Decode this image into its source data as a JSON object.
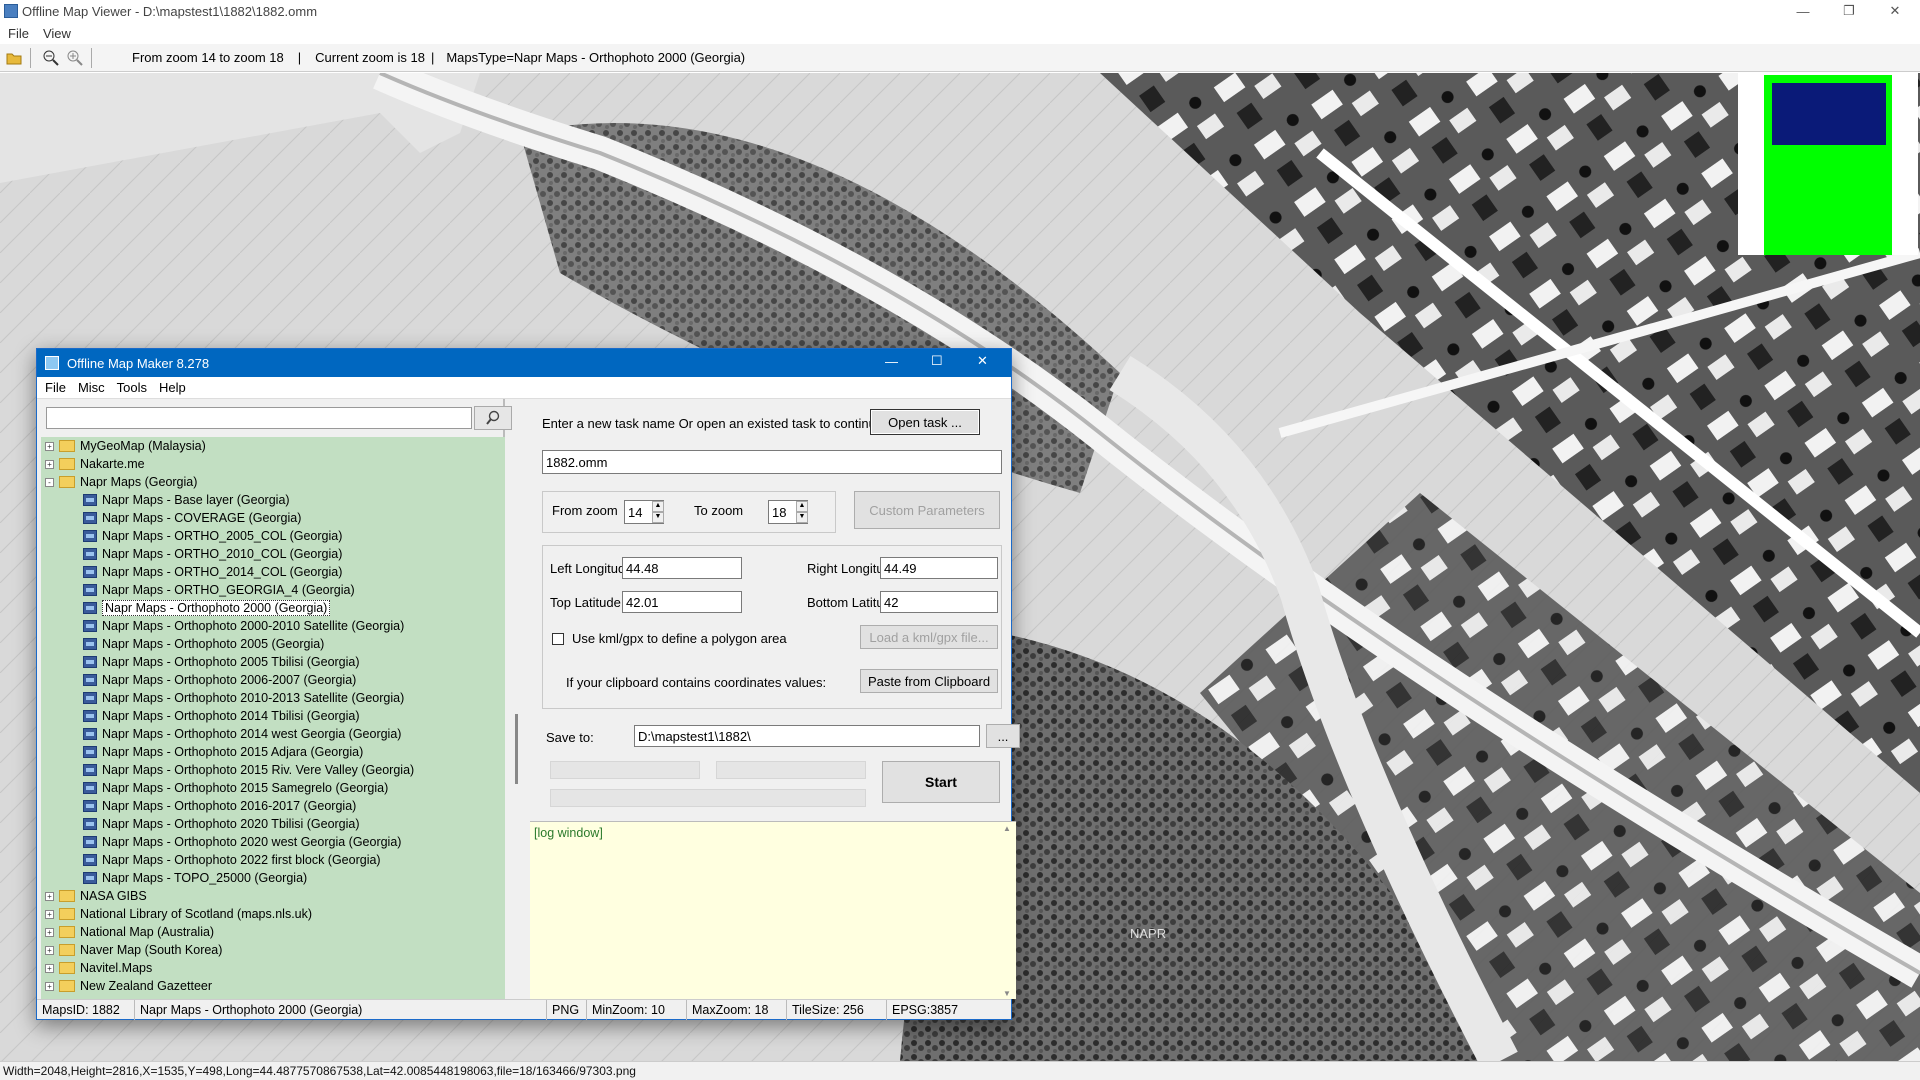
{
  "outer": {
    "title": "Offline Map Viewer - D:\\mapstest1\\1882\\1882.omm",
    "menu": [
      "File",
      "View"
    ],
    "toolbar_info": {
      "zoom_range": "From zoom 14 to zoom 18",
      "current_zoom": "Current zoom is 18",
      "maps_type": "MapsType=Napr Maps - Orthophoto 2000 (Georgia)"
    },
    "map_watermark": "NAPR",
    "status": "Width=2048,Height=2816,X=1535,Y=498,Long=44.4877570867538,Lat=42.0085448198063,file=18/163466/97303.png"
  },
  "colors": {
    "titlebar_blue": "#0067c0",
    "tree_bg": "#c2dfc2",
    "log_bg": "#ffffe0",
    "overview_green": "#00ff00",
    "overview_navy": "#0a1a78"
  },
  "inner": {
    "title": "Offline Map Maker 8.278",
    "menu": [
      "File",
      "Misc",
      "Tools",
      "Help"
    ],
    "search": {
      "value": ""
    },
    "tree": [
      {
        "label": "MyGeoMap (Malaysia)",
        "level": 0,
        "type": "folder",
        "state": "+"
      },
      {
        "label": "Nakarte.me",
        "level": 0,
        "type": "folder",
        "state": "+"
      },
      {
        "label": "Napr Maps (Georgia)",
        "level": 0,
        "type": "folder-open",
        "state": "-"
      },
      {
        "label": "Napr Maps - Base layer (Georgia)",
        "level": 1,
        "type": "map"
      },
      {
        "label": "Napr Maps - COVERAGE (Georgia)",
        "level": 1,
        "type": "map"
      },
      {
        "label": "Napr Maps - ORTHO_2005_COL (Georgia)",
        "level": 1,
        "type": "map"
      },
      {
        "label": "Napr Maps - ORTHO_2010_COL (Georgia)",
        "level": 1,
        "type": "map"
      },
      {
        "label": "Napr Maps - ORTHO_2014_COL (Georgia)",
        "level": 1,
        "type": "map"
      },
      {
        "label": "Napr Maps - ORTHO_GEORGIA_4 (Georgia)",
        "level": 1,
        "type": "map"
      },
      {
        "label": "Napr Maps - Orthophoto 2000 (Georgia)",
        "level": 1,
        "type": "map",
        "selected": true
      },
      {
        "label": "Napr Maps - Orthophoto 2000-2010 Satellite (Georgia)",
        "level": 1,
        "type": "map"
      },
      {
        "label": "Napr Maps - Orthophoto 2005 (Georgia)",
        "level": 1,
        "type": "map"
      },
      {
        "label": "Napr Maps - Orthophoto 2005 Tbilisi (Georgia)",
        "level": 1,
        "type": "map"
      },
      {
        "label": "Napr Maps - Orthophoto 2006-2007 (Georgia)",
        "level": 1,
        "type": "map"
      },
      {
        "label": "Napr Maps - Orthophoto 2010-2013 Satellite (Georgia)",
        "level": 1,
        "type": "map"
      },
      {
        "label": "Napr Maps - Orthophoto 2014 Tbilisi (Georgia)",
        "level": 1,
        "type": "map"
      },
      {
        "label": "Napr Maps - Orthophoto 2014 west Georgia (Georgia)",
        "level": 1,
        "type": "map"
      },
      {
        "label": "Napr Maps - Orthophoto 2015 Adjara (Georgia)",
        "level": 1,
        "type": "map"
      },
      {
        "label": "Napr Maps - Orthophoto 2015 Riv. Vere Valley (Georgia)",
        "level": 1,
        "type": "map"
      },
      {
        "label": "Napr Maps - Orthophoto 2015 Samegrelo (Georgia)",
        "level": 1,
        "type": "map"
      },
      {
        "label": "Napr Maps - Orthophoto 2016-2017 (Georgia)",
        "level": 1,
        "type": "map"
      },
      {
        "label": "Napr Maps - Orthophoto 2020 Tbilisi (Georgia)",
        "level": 1,
        "type": "map"
      },
      {
        "label": "Napr Maps - Orthophoto 2020 west Georgia (Georgia)",
        "level": 1,
        "type": "map"
      },
      {
        "label": "Napr Maps - Orthophoto 2022 first block (Georgia)",
        "level": 1,
        "type": "map"
      },
      {
        "label": "Napr Maps - TOPO_25000 (Georgia)",
        "level": 1,
        "type": "map"
      },
      {
        "label": "NASA GIBS",
        "level": 0,
        "type": "folder",
        "state": "+"
      },
      {
        "label": "National Library of Scotland (maps.nls.uk)",
        "level": 0,
        "type": "folder",
        "state": "+"
      },
      {
        "label": "National Map (Australia)",
        "level": 0,
        "type": "folder",
        "state": "+"
      },
      {
        "label": "Naver Map (South Korea)",
        "level": 0,
        "type": "folder",
        "state": "+"
      },
      {
        "label": "Navitel.Maps",
        "level": 0,
        "type": "folder",
        "state": "+"
      },
      {
        "label": "New Zealand Gazetteer",
        "level": 0,
        "type": "folder",
        "state": "+"
      }
    ],
    "task_prompt": "Enter a new task name Or open an existed task to continue:",
    "open_task_label": "Open task ...",
    "task_name": "1882.omm",
    "from_zoom_label": "From zoom",
    "from_zoom": "14",
    "to_zoom_label": "To zoom",
    "to_zoom": "18",
    "custom_params_label": "Custom Parameters",
    "left_lon_label": "Left Longitude",
    "left_lon": "44.48",
    "right_lon_label": "Right Longitude",
    "right_lon": "44.49",
    "top_lat_label": "Top Latitude",
    "top_lat": "42.01",
    "bottom_lat_label": "Bottom Latitude",
    "bottom_lat": "42",
    "kml_label": "Use kml/gpx to define a polygon area",
    "load_kml_label": "Load a kml/gpx file...",
    "clipboard_prompt": "If your clipboard contains coordinates values:",
    "paste_label": "Paste from Clipboard",
    "save_to_label": "Save to:",
    "save_path": "D:\\mapstest1\\1882\\",
    "browse_label": "...",
    "start_label": "Start",
    "log_text": "[log window]",
    "status": {
      "maps_id": "MapsID: 1882",
      "map_name": "Napr Maps - Orthophoto 2000 (Georgia)",
      "format": "PNG",
      "min_zoom": "MinZoom: 10",
      "max_zoom": "MaxZoom: 18",
      "tile_size": "TileSize: 256",
      "epsg": "EPSG:3857"
    }
  }
}
